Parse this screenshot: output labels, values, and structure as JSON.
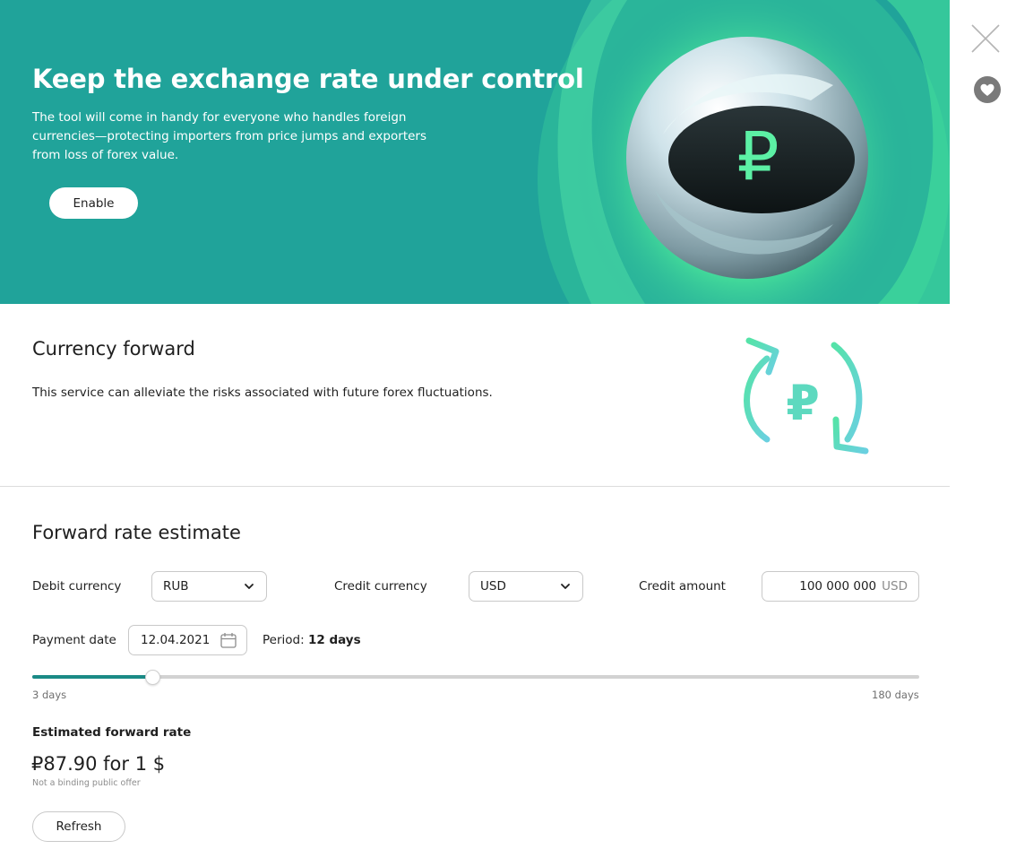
{
  "hero": {
    "title": "Keep the exchange rate under control",
    "description": "The tool will come in handy for everyone who handles foreign currencies—protecting importers from price jumps and exporters from loss of forex value.",
    "button_label": "Enable",
    "background_color": "#20a39a",
    "art_symbol": "₽"
  },
  "side_actions": {
    "close_icon": "close-icon",
    "favorite_icon": "heart-icon"
  },
  "product": {
    "title": "Currency forward",
    "description": "This service can alleviate the risks associated with future forex fluctuations.",
    "icon": "ruble-exchange-icon",
    "icon_symbol": "₽"
  },
  "calculator": {
    "title": "Forward rate estimate",
    "debit_currency": {
      "label": "Debit currency",
      "value": "RUB"
    },
    "credit_currency": {
      "label": "Credit currency",
      "value": "USD"
    },
    "credit_amount": {
      "label": "Credit amount",
      "value": "100 000 000",
      "currency": "USD"
    },
    "payment_date": {
      "label": "Payment date",
      "value": "12.04.2021"
    },
    "period": {
      "label": "Period:",
      "value": "12 days"
    },
    "slider": {
      "min_label": "3 days",
      "max_label": "180 days",
      "min": 3,
      "max": 180,
      "value": 27
    },
    "estimate": {
      "label": "Estimated forward rate",
      "value": "₽87.90 for 1 $",
      "note": "Not a binding public offer"
    },
    "refresh_label": "Refresh",
    "accent_color": "#1a8a86"
  }
}
